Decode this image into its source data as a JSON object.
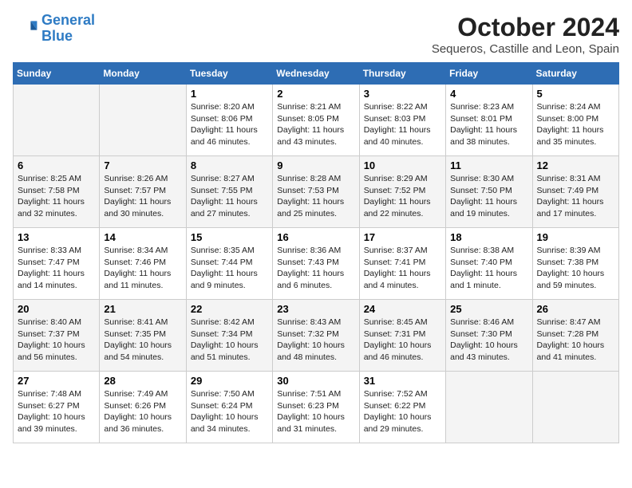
{
  "header": {
    "logo_line1": "General",
    "logo_line2": "Blue",
    "month_title": "October 2024",
    "location": "Sequeros, Castille and Leon, Spain"
  },
  "calendar": {
    "days_of_week": [
      "Sunday",
      "Monday",
      "Tuesday",
      "Wednesday",
      "Thursday",
      "Friday",
      "Saturday"
    ],
    "weeks": [
      [
        {
          "day": "",
          "info": ""
        },
        {
          "day": "",
          "info": ""
        },
        {
          "day": "1",
          "info": "Sunrise: 8:20 AM\nSunset: 8:06 PM\nDaylight: 11 hours and 46 minutes."
        },
        {
          "day": "2",
          "info": "Sunrise: 8:21 AM\nSunset: 8:05 PM\nDaylight: 11 hours and 43 minutes."
        },
        {
          "day": "3",
          "info": "Sunrise: 8:22 AM\nSunset: 8:03 PM\nDaylight: 11 hours and 40 minutes."
        },
        {
          "day": "4",
          "info": "Sunrise: 8:23 AM\nSunset: 8:01 PM\nDaylight: 11 hours and 38 minutes."
        },
        {
          "day": "5",
          "info": "Sunrise: 8:24 AM\nSunset: 8:00 PM\nDaylight: 11 hours and 35 minutes."
        }
      ],
      [
        {
          "day": "6",
          "info": "Sunrise: 8:25 AM\nSunset: 7:58 PM\nDaylight: 11 hours and 32 minutes."
        },
        {
          "day": "7",
          "info": "Sunrise: 8:26 AM\nSunset: 7:57 PM\nDaylight: 11 hours and 30 minutes."
        },
        {
          "day": "8",
          "info": "Sunrise: 8:27 AM\nSunset: 7:55 PM\nDaylight: 11 hours and 27 minutes."
        },
        {
          "day": "9",
          "info": "Sunrise: 8:28 AM\nSunset: 7:53 PM\nDaylight: 11 hours and 25 minutes."
        },
        {
          "day": "10",
          "info": "Sunrise: 8:29 AM\nSunset: 7:52 PM\nDaylight: 11 hours and 22 minutes."
        },
        {
          "day": "11",
          "info": "Sunrise: 8:30 AM\nSunset: 7:50 PM\nDaylight: 11 hours and 19 minutes."
        },
        {
          "day": "12",
          "info": "Sunrise: 8:31 AM\nSunset: 7:49 PM\nDaylight: 11 hours and 17 minutes."
        }
      ],
      [
        {
          "day": "13",
          "info": "Sunrise: 8:33 AM\nSunset: 7:47 PM\nDaylight: 11 hours and 14 minutes."
        },
        {
          "day": "14",
          "info": "Sunrise: 8:34 AM\nSunset: 7:46 PM\nDaylight: 11 hours and 11 minutes."
        },
        {
          "day": "15",
          "info": "Sunrise: 8:35 AM\nSunset: 7:44 PM\nDaylight: 11 hours and 9 minutes."
        },
        {
          "day": "16",
          "info": "Sunrise: 8:36 AM\nSunset: 7:43 PM\nDaylight: 11 hours and 6 minutes."
        },
        {
          "day": "17",
          "info": "Sunrise: 8:37 AM\nSunset: 7:41 PM\nDaylight: 11 hours and 4 minutes."
        },
        {
          "day": "18",
          "info": "Sunrise: 8:38 AM\nSunset: 7:40 PM\nDaylight: 11 hours and 1 minute."
        },
        {
          "day": "19",
          "info": "Sunrise: 8:39 AM\nSunset: 7:38 PM\nDaylight: 10 hours and 59 minutes."
        }
      ],
      [
        {
          "day": "20",
          "info": "Sunrise: 8:40 AM\nSunset: 7:37 PM\nDaylight: 10 hours and 56 minutes."
        },
        {
          "day": "21",
          "info": "Sunrise: 8:41 AM\nSunset: 7:35 PM\nDaylight: 10 hours and 54 minutes."
        },
        {
          "day": "22",
          "info": "Sunrise: 8:42 AM\nSunset: 7:34 PM\nDaylight: 10 hours and 51 minutes."
        },
        {
          "day": "23",
          "info": "Sunrise: 8:43 AM\nSunset: 7:32 PM\nDaylight: 10 hours and 48 minutes."
        },
        {
          "day": "24",
          "info": "Sunrise: 8:45 AM\nSunset: 7:31 PM\nDaylight: 10 hours and 46 minutes."
        },
        {
          "day": "25",
          "info": "Sunrise: 8:46 AM\nSunset: 7:30 PM\nDaylight: 10 hours and 43 minutes."
        },
        {
          "day": "26",
          "info": "Sunrise: 8:47 AM\nSunset: 7:28 PM\nDaylight: 10 hours and 41 minutes."
        }
      ],
      [
        {
          "day": "27",
          "info": "Sunrise: 7:48 AM\nSunset: 6:27 PM\nDaylight: 10 hours and 39 minutes."
        },
        {
          "day": "28",
          "info": "Sunrise: 7:49 AM\nSunset: 6:26 PM\nDaylight: 10 hours and 36 minutes."
        },
        {
          "day": "29",
          "info": "Sunrise: 7:50 AM\nSunset: 6:24 PM\nDaylight: 10 hours and 34 minutes."
        },
        {
          "day": "30",
          "info": "Sunrise: 7:51 AM\nSunset: 6:23 PM\nDaylight: 10 hours and 31 minutes."
        },
        {
          "day": "31",
          "info": "Sunrise: 7:52 AM\nSunset: 6:22 PM\nDaylight: 10 hours and 29 minutes."
        },
        {
          "day": "",
          "info": ""
        },
        {
          "day": "",
          "info": ""
        }
      ]
    ]
  }
}
